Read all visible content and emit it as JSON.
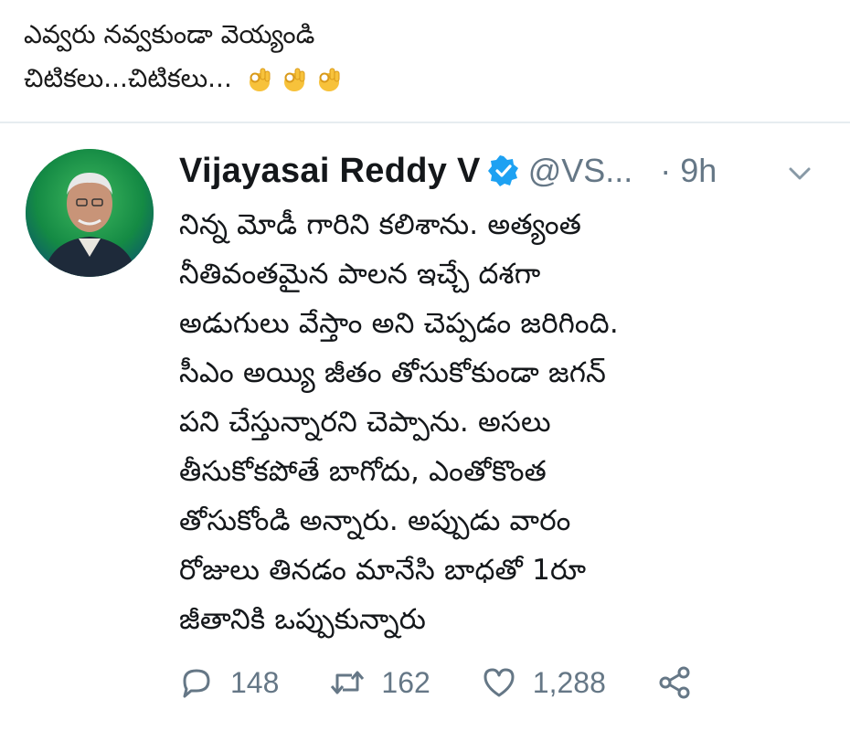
{
  "caption": {
    "line1": "ఎవ్వరు నవ్వకుండా వెయ్యండి",
    "line2": "చిటికలు...చిటికలు...",
    "emojis": [
      "ok-hand-emoji",
      "ok-hand-emoji",
      "ok-hand-emoji"
    ]
  },
  "tweet": {
    "display_name": "Vijayasai Reddy V",
    "handle": "@VS...",
    "time": "· 9h",
    "verified": true,
    "body_lines": [
      "నిన్న మోడీ గారిని కలిశాను. అత్యంత",
      "నీతివంతమైన పాలన ఇచ్చే దశగా",
      "అడుగులు వేస్తాం అని చెప్పడం జరిగింది.",
      "సీఎం అయ్యి  జీతం తోసుకోకుండా జగన్",
      "పని చేస్తున్నారని చెప్పాను. అసలు",
      "తీసుకోకపోతే బాగోదు, ఎంతోకొంత",
      "తోసుకోండి అన్నారు. అప్పుడు వారం",
      "రోజులు తినడం మానేసి బాధతో 1రూ",
      "జీతానికి ఒప్పుకున్నారు"
    ],
    "replies": "148",
    "retweets": "162",
    "likes": "1,288",
    "icons": {
      "reply": "reply-icon",
      "retweet": "retweet-icon",
      "like": "heart-icon",
      "share": "share-icon",
      "menu": "chevron-down-icon"
    },
    "colors": {
      "verified": "#1da1f2",
      "muted": "#657786",
      "avatar_bg": "#0e7a3d"
    }
  }
}
